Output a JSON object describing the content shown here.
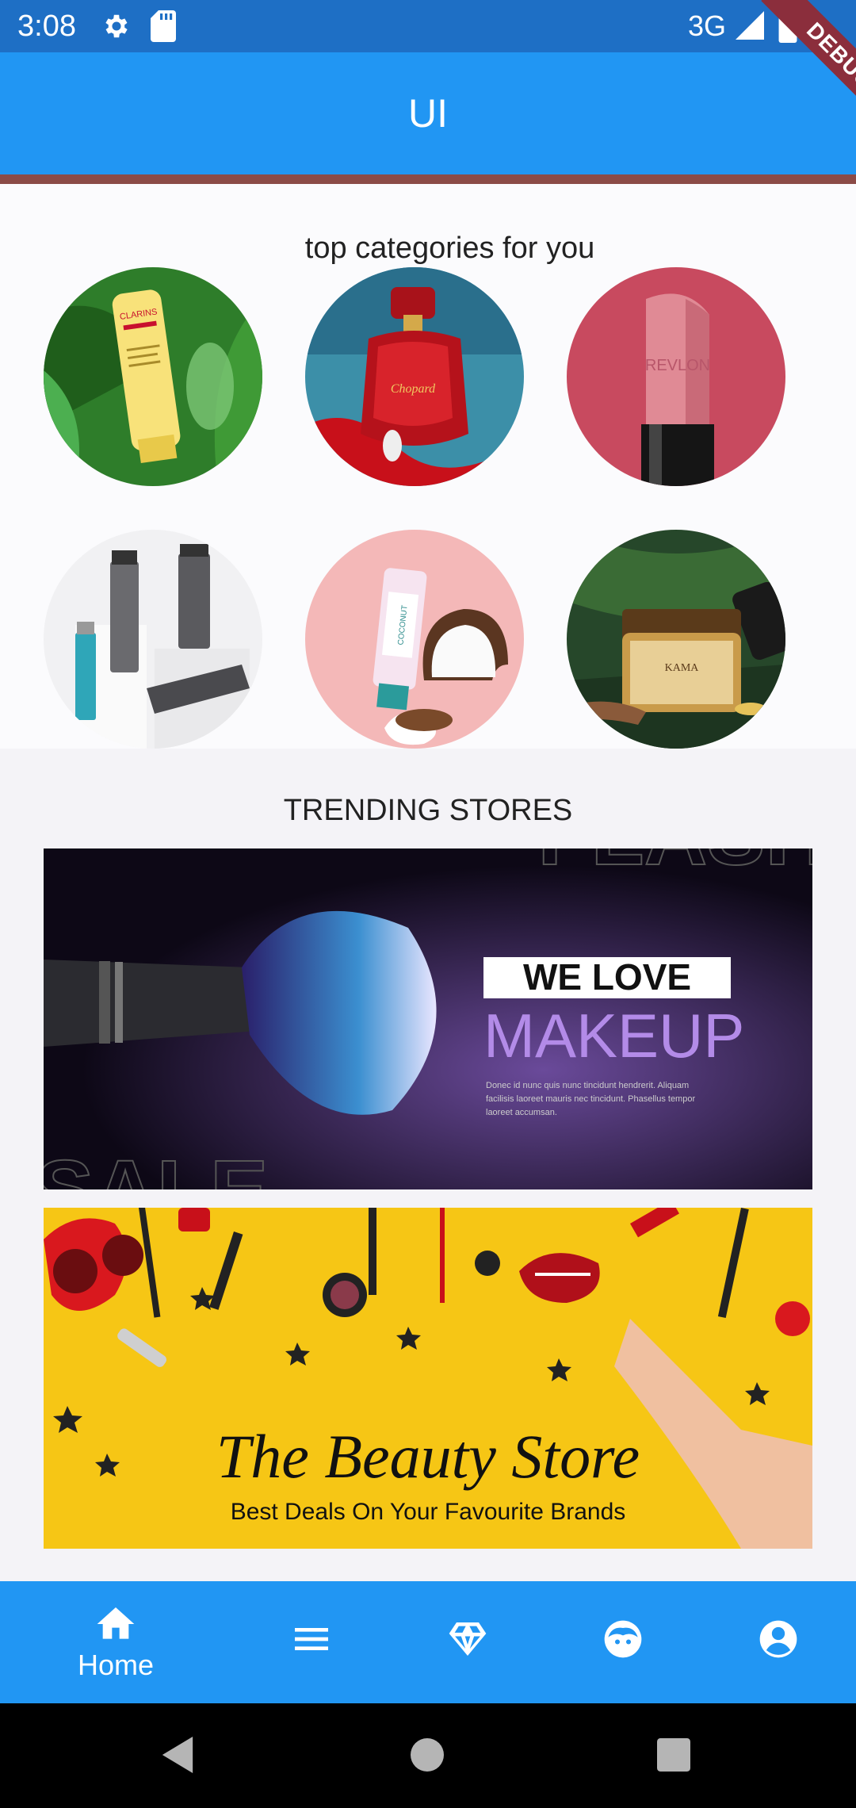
{
  "status_bar": {
    "time": "3:08",
    "network": "3G"
  },
  "app_bar": {
    "title": "UI"
  },
  "debug_banner": {
    "label": "DEBUG"
  },
  "categories": {
    "title": "top categories for you",
    "items": [
      {
        "name": "skincare-cream",
        "brand": "CLARINS"
      },
      {
        "name": "fragrance",
        "brand": "Chopard"
      },
      {
        "name": "lipstick",
        "brand": "REVLON"
      },
      {
        "name": "mens-grooming",
        "brand": ""
      },
      {
        "name": "coconut-product",
        "brand": "COCONUT"
      },
      {
        "name": "face-cream-jar",
        "brand": "KAMA"
      }
    ]
  },
  "trending": {
    "title": "TRENDING STORES",
    "banners": [
      {
        "name": "makeup-banner",
        "headline_small": "WE LOVE",
        "headline_large": "MAKEUP",
        "body_lines": [
          "Donec id nunc quis nunc tincidunt hendrerit. Aliquam",
          "facilisis laoreet mauris nec tincidunt. Phasellus tempor",
          "laoreet accumsan."
        ],
        "background_word_top": "FLASH",
        "background_word_bottom": "SALE"
      },
      {
        "name": "beauty-store-banner",
        "headline": "The Beauty Store",
        "subline": "Best Deals On Your Favourite Brands"
      }
    ]
  },
  "bottom_nav": {
    "items": [
      {
        "icon": "home-icon",
        "label": "Home",
        "active": true
      },
      {
        "icon": "menu-icon",
        "label": ""
      },
      {
        "icon": "diamond-icon",
        "label": ""
      },
      {
        "icon": "face-icon",
        "label": ""
      },
      {
        "icon": "account-icon",
        "label": ""
      }
    ]
  },
  "colors": {
    "primary": "#2196f3",
    "status_bar": "#1e6fc5",
    "accent_strip": "#8b4b47",
    "debug": "#8b2e3c"
  }
}
